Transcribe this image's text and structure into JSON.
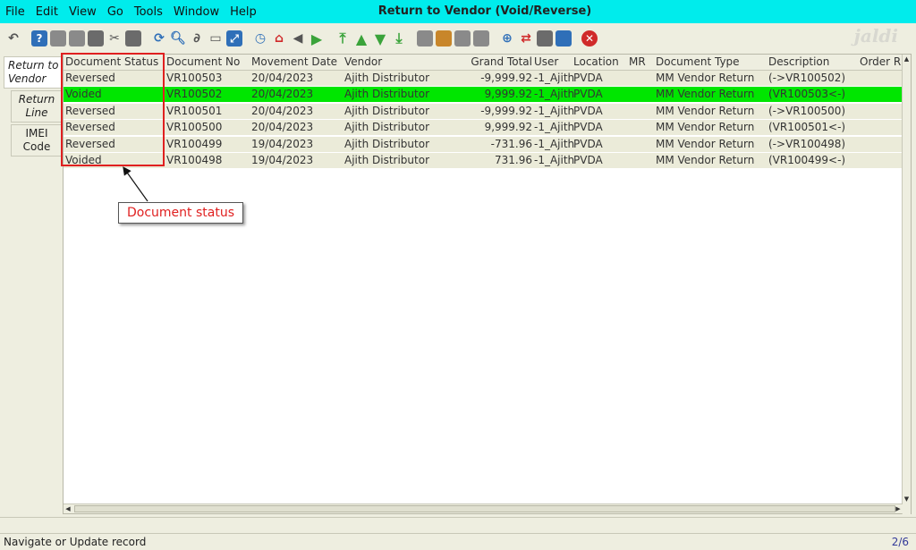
{
  "menu": {
    "file": "File",
    "edit": "Edit",
    "view": "View",
    "go": "Go",
    "tools": "Tools",
    "window": "Window",
    "help": "Help"
  },
  "window_title": "Return to Vendor (Void/Reverse)",
  "logo": "jaldi",
  "toolbar_icons": [
    "undo-icon",
    "help-icon",
    "new-icon",
    "copy-icon",
    "delete-icon",
    "tools-icon",
    "save-icon",
    "refresh-icon",
    "find-icon",
    "attachment-icon",
    "chat-icon",
    "expand-icon",
    "history-icon",
    "home-icon",
    "back-icon",
    "forward-icon",
    "first-record-icon",
    "previous-record-icon",
    "next-record-icon",
    "last-record-icon",
    "report-icon",
    "archive-icon",
    "print-icon",
    "print-preview-icon",
    "zoom-icon",
    "workflow-icon",
    "process-icon",
    "product-icon",
    "exit-icon"
  ],
  "tabs": {
    "return_to_vendor": "Return to Vendor",
    "return_line": "Return Line",
    "imei_code": "IMEI Code"
  },
  "columns": {
    "status": "Document Status",
    "doc": "Document No",
    "date": "Movement Date",
    "vendor": "Vendor",
    "total": "Grand Total",
    "user": "User",
    "loc": "Location",
    "mr": "MR",
    "type": "Document Type",
    "desc": "Description",
    "order": "Order R"
  },
  "rows": [
    {
      "status": "Reversed",
      "doc": "VR100503",
      "date": "20/04/2023",
      "vendor": "Ajith Distributor",
      "total": "-9,999.92",
      "user": "-1_Ajith",
      "loc": "PVDA",
      "mr": "",
      "type": "MM Vendor Return",
      "desc": "(->VR100502)",
      "order": ""
    },
    {
      "status": "Voided",
      "doc": "VR100502",
      "date": "20/04/2023",
      "vendor": "Ajith Distributor",
      "total": "9,999.92",
      "user": "-1_Ajith",
      "loc": "PVDA",
      "mr": "",
      "type": "MM Vendor Return",
      "desc": "(VR100503<-)",
      "order": ""
    },
    {
      "status": "Reversed",
      "doc": "VR100501",
      "date": "20/04/2023",
      "vendor": "Ajith Distributor",
      "total": "-9,999.92",
      "user": "-1_Ajith",
      "loc": "PVDA",
      "mr": "",
      "type": "MM Vendor Return",
      "desc": "(->VR100500)",
      "order": ""
    },
    {
      "status": "Reversed",
      "doc": "VR100500",
      "date": "20/04/2023",
      "vendor": "Ajith Distributor",
      "total": "9,999.92",
      "user": "-1_Ajith",
      "loc": "PVDA",
      "mr": "",
      "type": "MM Vendor Return",
      "desc": "(VR100501<-)",
      "order": ""
    },
    {
      "status": "Reversed",
      "doc": "VR100499",
      "date": "19/04/2023",
      "vendor": "Ajith Distributor",
      "total": "-731.96",
      "user": "-1_Ajith",
      "loc": "PVDA",
      "mr": "",
      "type": "MM Vendor Return",
      "desc": "(->VR100498)",
      "order": ""
    },
    {
      "status": "Voided",
      "doc": "VR100498",
      "date": "19/04/2023",
      "vendor": "Ajith Distributor",
      "total": "731.96",
      "user": "-1_Ajith",
      "loc": "PVDA",
      "mr": "",
      "type": "MM Vendor Return",
      "desc": "(VR100499<-)",
      "order": ""
    }
  ],
  "selected_row_index": 1,
  "annotation": "Document status",
  "status": {
    "message": "Navigate or Update record",
    "record_count": "2/6"
  },
  "colors": {
    "titlebar": "#00ecec",
    "selected_row": "#00e600",
    "annotation": "#e02020"
  }
}
